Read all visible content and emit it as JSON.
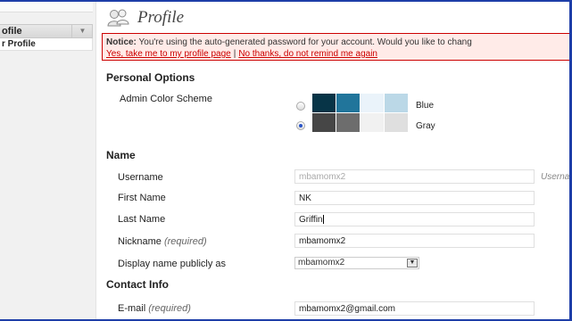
{
  "sidebar": {
    "menu_head": "ofile",
    "submenu_item": "r Profile"
  },
  "page": {
    "title": "Profile",
    "icon": "users-icon"
  },
  "notice": {
    "label": "Notice:",
    "text": "You're using the auto-generated password for your account. Would you like to chang",
    "link_yes": "Yes, take me to my profile page",
    "separator": "|",
    "link_no": "No thanks, do not remind me again"
  },
  "personal_options": {
    "heading": "Personal Options",
    "color_scheme_label": "Admin Color Scheme",
    "schemes": [
      {
        "name": "Blue",
        "selected": false,
        "colors": [
          "#073447",
          "#21759b",
          "#eaf3fa",
          "#bbd8e7"
        ]
      },
      {
        "name": "Gray",
        "selected": true,
        "colors": [
          "#464646",
          "#6d6d6d",
          "#f1f1f1",
          "#dfdfdf"
        ]
      }
    ]
  },
  "name_section": {
    "heading": "Name",
    "username_label": "Username",
    "username_value": "mbamomx2",
    "username_note": "Userna",
    "first_name_label": "First Name",
    "first_name_value": "NK",
    "last_name_label": "Last Name",
    "last_name_value": "Griffin",
    "nickname_label": "Nickname",
    "nickname_required": "(required)",
    "nickname_value": "mbamomx2",
    "display_name_label": "Display name publicly as",
    "display_name_value": "mbamomx2"
  },
  "contact_info": {
    "heading": "Contact Info",
    "email_label": "E-mail",
    "email_required": "(required)",
    "email_value": "mbamomx2@gmail.com"
  }
}
